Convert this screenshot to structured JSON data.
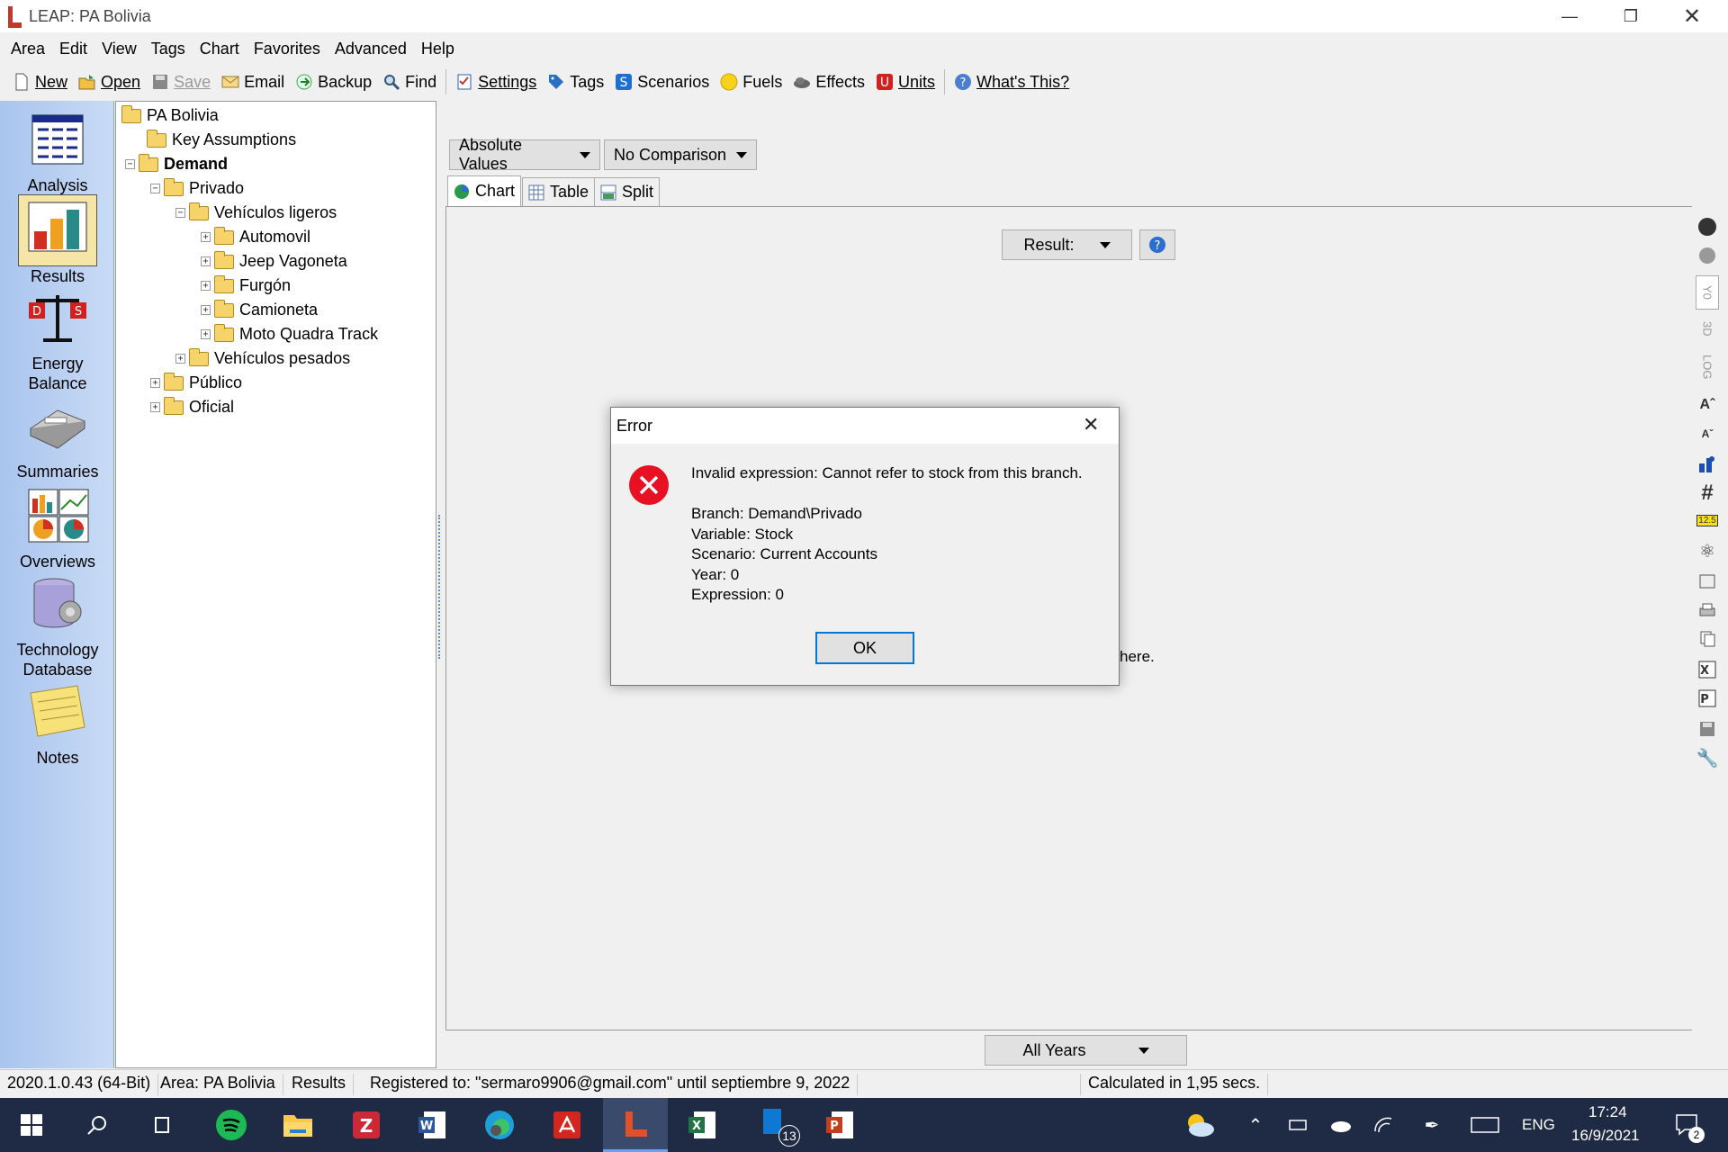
{
  "window": {
    "title": "LEAP: PA Bolivia"
  },
  "menu": [
    "Area",
    "Edit",
    "View",
    "Tags",
    "Chart",
    "Favorites",
    "Advanced",
    "Help"
  ],
  "toolbar": {
    "new": "New",
    "open": "Open",
    "save": "Save",
    "email": "Email",
    "backup": "Backup",
    "find": "Find",
    "settings": "Settings",
    "tags": "Tags",
    "scenarios": "Scenarios",
    "fuels": "Fuels",
    "effects": "Effects",
    "units": "Units",
    "whats_this": "What's This?"
  },
  "nav": {
    "analysis": "Analysis",
    "results": "Results",
    "energy1": "Energy",
    "energy2": "Balance",
    "summaries": "Summaries",
    "overviews": "Overviews",
    "tech1": "Technology",
    "tech2": "Database",
    "notes": "Notes"
  },
  "tree": {
    "root": "PA Bolivia",
    "key_assumptions": "Key Assumptions",
    "demand": "Demand",
    "privado": "Privado",
    "vehiculos_ligeros": "Vehículos ligeros",
    "automovil": "Automovil",
    "jeep": "Jeep Vagoneta",
    "furgon": "Furgón",
    "camioneta": "Camioneta",
    "moto": "Moto Quadra Track",
    "vehiculos_pesados": "Vehículos pesados",
    "publico": "Público",
    "oficial": "Oficial"
  },
  "main": {
    "values_dd": "Absolute Values",
    "comparison_dd": "No Comparison",
    "tabs": {
      "chart": "Chart",
      "table": "Table",
      "split": "Split"
    },
    "result_dd": "Result:",
    "years_dd": "All Years",
    "partial_text": "here."
  },
  "rightbar": {
    "yo": "Y0",
    "d3": "3D",
    "log": "LOG",
    "num": "12.5"
  },
  "dialog": {
    "title": "Error",
    "message": "Invalid expression: Cannot refer to stock from this branch.",
    "branch": "Branch: Demand\\Privado",
    "variable": "Variable: Stock",
    "scenario": "Scenario: Current Accounts",
    "year": "Year: 0",
    "expression": "Expression: 0",
    "ok": "OK"
  },
  "status": {
    "version": "2020.1.0.43 (64-Bit)",
    "area": "Area: PA Bolivia",
    "view": "Results",
    "registered": "Registered to: \"sermaro9906@gmail.com\" until septiembre 9, 2022",
    "calc": "Calculated in 1,95 secs."
  },
  "taskbar": {
    "lang": "ENG",
    "time": "17:24",
    "date": "16/9/2021",
    "badge_outlook": "13",
    "notif": "2"
  },
  "colors": {
    "error_red": "#e81123",
    "accent": "#0078d7",
    "nav_bg": "#b7cdf1",
    "taskbar": "#1f2a44"
  }
}
